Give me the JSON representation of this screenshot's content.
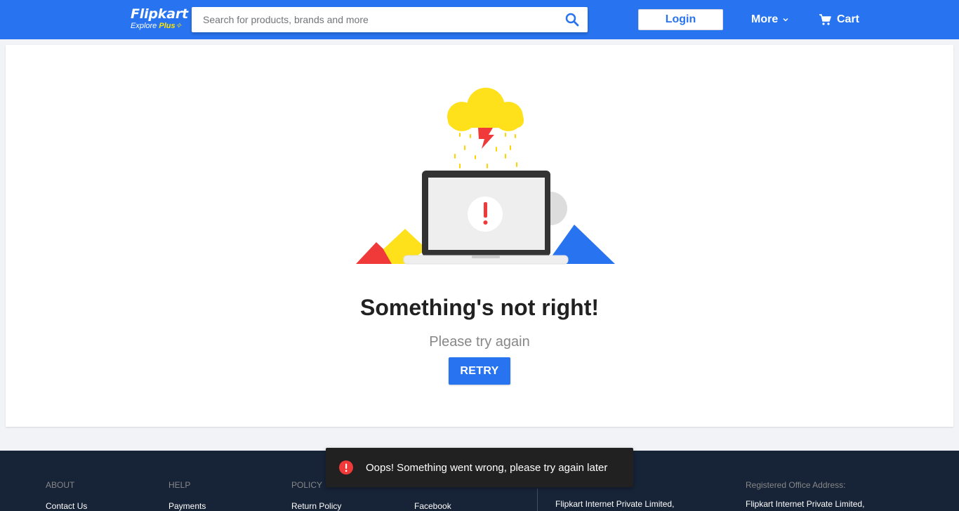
{
  "header": {
    "logo_main": "Flipkart",
    "logo_sub_explore": "Explore",
    "logo_sub_plus": "Plus",
    "search_placeholder": "Search for products, brands and more",
    "login_label": "Login",
    "more_label": "More",
    "cart_label": "Cart"
  },
  "error": {
    "title": "Something's not right!",
    "subtitle": "Please try again",
    "retry_label": "RETRY"
  },
  "toast": {
    "message": "Oops! Something went wrong, please try again later"
  },
  "footer": {
    "columns": [
      {
        "heading": "ABOUT",
        "first_link": "Contact Us"
      },
      {
        "heading": "HELP",
        "first_link": "Payments"
      },
      {
        "heading": "POLICY",
        "first_link": "Return Policy"
      },
      {
        "heading": "",
        "first_link": "Facebook"
      }
    ],
    "mail_line": "Flipkart Internet Private Limited,",
    "registered_heading": "Registered Office Address:",
    "registered_line": "Flipkart Internet Private Limited,"
  },
  "colors": {
    "brand_blue": "#2874f0",
    "brand_yellow": "#ffe500",
    "footer_bg": "#172337",
    "error_red": "#f0383e"
  }
}
